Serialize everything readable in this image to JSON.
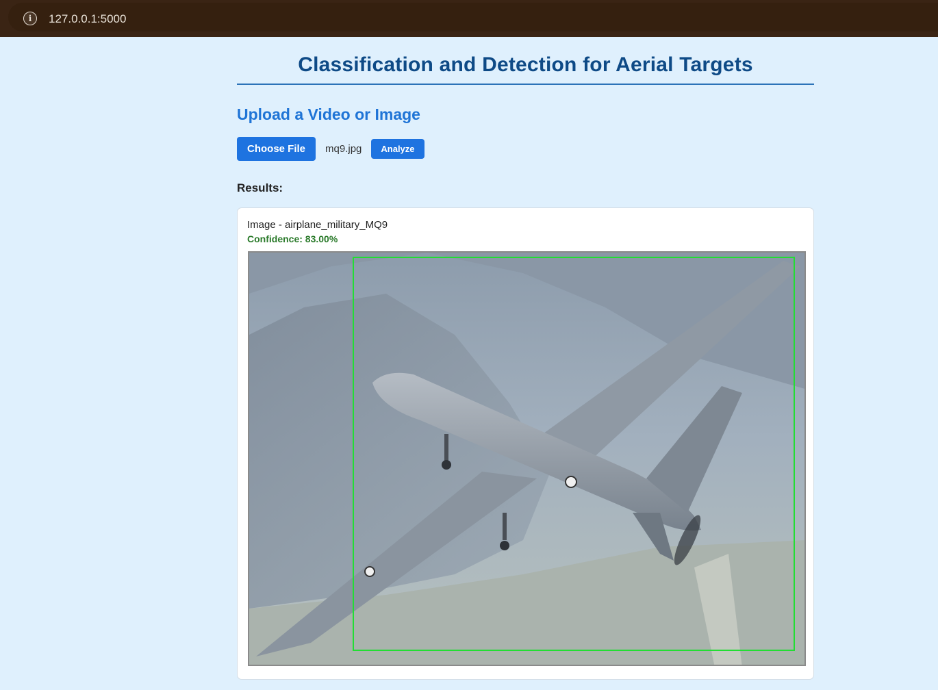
{
  "browser": {
    "url": "127.0.0.1:5000"
  },
  "page": {
    "title": "Classification and Detection for Aerial Targets",
    "upload_heading": "Upload a Video or Image",
    "choose_file_label": "Choose File",
    "selected_file": "mq9.jpg",
    "analyze_label": "Analyze",
    "results_label": "Results:"
  },
  "result": {
    "label": "Image - airplane_military_MQ9",
    "confidence": "Confidence: 83.00%"
  },
  "colors": {
    "accent": "#1e73e0",
    "title": "#0e4a86",
    "confidence": "#2a7a2a",
    "detection_box": "#22dd33"
  }
}
